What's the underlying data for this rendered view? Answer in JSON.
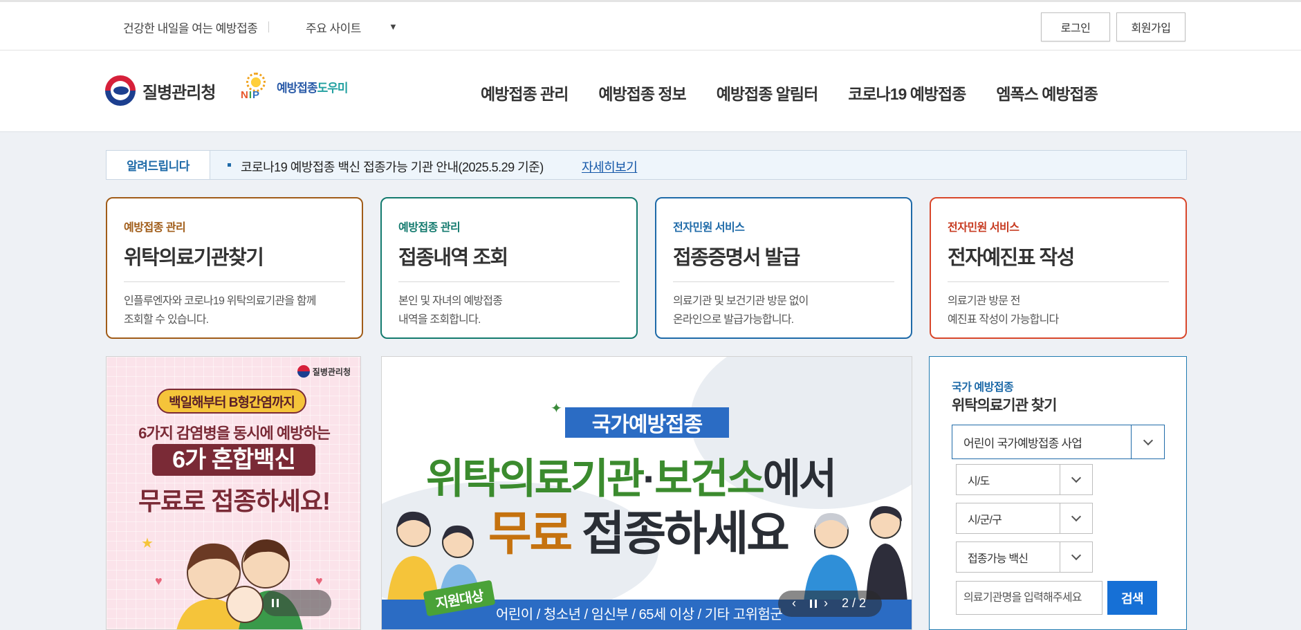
{
  "util": {
    "slogan": "건강한 내일을 여는 예방접종",
    "sites_label": "주요 사이트",
    "login": "로그인",
    "join": "회원가입"
  },
  "header": {
    "kdca_logo_text": "질병관리청",
    "nip_letters": [
      "N",
      "I",
      "P"
    ],
    "nip_text_a": "예방접종",
    "nip_text_b": "도우미",
    "nav": [
      "예방접종 관리",
      "예방접종 정보",
      "예방접종 알림터",
      "코로나19 예방접종",
      "엠폭스 예방접종"
    ]
  },
  "notice": {
    "tag": "알려드립니다",
    "text": "코로나19 예방접종 백신 접종가능 기관 안내(2025.5.29 기준)",
    "more": "자세히보기"
  },
  "cards": [
    {
      "category": "예방접종 관리",
      "title": "위탁의료기관찾기",
      "desc": "인플루엔자와 코로나19 위탁의료기관을 함께\n조회할 수 있습니다.",
      "color": "#a05c18"
    },
    {
      "category": "예방접종 관리",
      "title": "접종내역 조회",
      "desc": "본인 및 자녀의 예방접종\n내역을 조회합니다.",
      "color": "#137a6e"
    },
    {
      "category": "전자민원 서비스",
      "title": "접종증명서 발급",
      "desc": "의료기관 및 보건기관 방문 없이\n온라인으로 발급가능합니다.",
      "color": "#1e6aa8"
    },
    {
      "category": "전자민원 서비스",
      "title": "전자예진표 작성",
      "desc": "의료기관 방문 전\n예진표 작성이 가능합니다",
      "color": "#d8462a"
    }
  ],
  "banner_left": {
    "logo_text": "질병관리청",
    "pill": "백일해부터 B형간염까지",
    "line1": "6가지 감염병을 동시에 예방하는",
    "line2": "6가 혼합백신",
    "line3": "무료로 접종하세요!"
  },
  "banner_center": {
    "tag": "국가예방접종",
    "line1_green_a": "위탁의료기관",
    "line1_dot": "·",
    "line1_green_b": "보건소",
    "line1_dark": "에서",
    "line2_orange": "무료",
    "line2_dark": " 접종하세요",
    "badge": "지원대상",
    "strip": "어린이 / 청소년 / 임신부 / 65세 이상 / 기타 고위험군",
    "counter": "2 / 2"
  },
  "search": {
    "category": "국가 예방접종",
    "title": "위탁의료기관 찾기",
    "program_select": "어린이 국가예방접종 사업",
    "sido": "시/도",
    "sigungu": "시/군/구",
    "vaccine": "접종가능 백신",
    "input_placeholder": "의료기관명을 입력해주세요",
    "button": "검색"
  }
}
